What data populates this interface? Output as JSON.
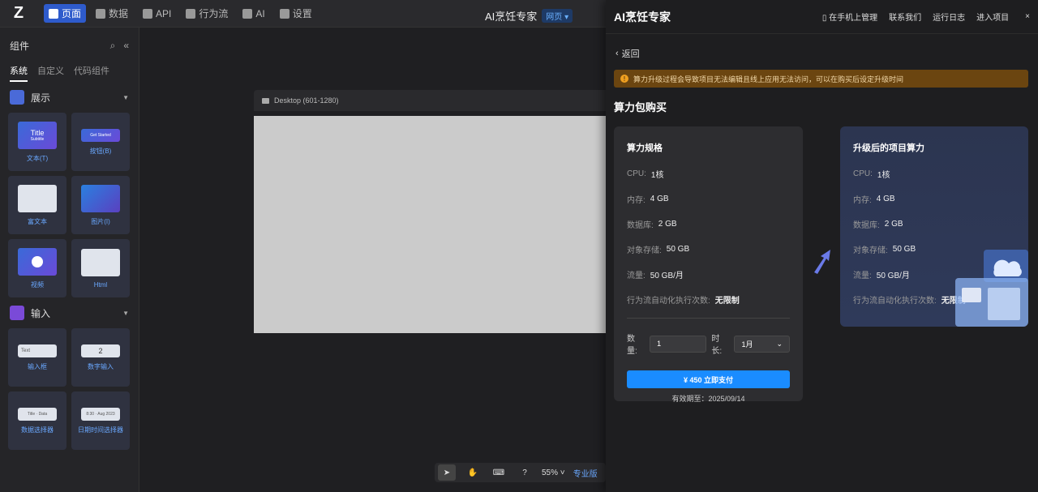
{
  "topbar": {
    "nav": [
      {
        "label": "页面",
        "icon": "page-icon",
        "active": true
      },
      {
        "label": "数据",
        "icon": "database-icon",
        "active": false
      },
      {
        "label": "API",
        "icon": "api-icon",
        "active": false
      },
      {
        "label": "行为流",
        "icon": "flow-icon",
        "active": false
      },
      {
        "label": "AI",
        "icon": "ai-icon",
        "active": false
      },
      {
        "label": "设置",
        "icon": "gear-icon",
        "active": false
      }
    ],
    "app_title": "AI烹饪专家",
    "app_badge": "网页"
  },
  "sidebar": {
    "title": "组件",
    "tabs": [
      "系统",
      "自定义",
      "代码组件"
    ],
    "section_display": "展示",
    "section_input": "输入",
    "display_items": [
      "文本(T)",
      "按钮(B)",
      "富文本",
      "图片(I)",
      "视频",
      "Html"
    ],
    "input_items": [
      "输入框",
      "数字输入",
      "数据选择器",
      "日期时间选择器"
    ],
    "thumb_text": {
      "title": "Title",
      "subtitle": "Subtitle",
      "get_started": "Get Started",
      "input_text": "Text",
      "stepper_value": "2",
      "select_text": "Title · Data",
      "date_text": "8:30 · Aug 2023"
    }
  },
  "canvas": {
    "frame_label": "Desktop (601-1280)"
  },
  "bottombar": {
    "zoom": "55%",
    "plan": "专业版"
  },
  "panel": {
    "title": "AI烹饪专家",
    "links": [
      "在手机上管理",
      "联系我们",
      "运行日志",
      "进入项目"
    ],
    "back": "返回",
    "warning": "算力升级过程会导致项目无法编辑且线上应用无法访问，可以在购买后设定升级时间",
    "heading": "算力包购买",
    "left_card": {
      "title": "算力规格",
      "specs": [
        {
          "label": "CPU:",
          "value": "1核"
        },
        {
          "label": "内存:",
          "value": "4 GB"
        },
        {
          "label": "数据库:",
          "value": "2 GB"
        },
        {
          "label": "对象存储:",
          "value": "50 GB"
        },
        {
          "label": "流量:",
          "value": "50 GB/月"
        },
        {
          "label": "行为流自动化执行次数:",
          "value": "无限制"
        }
      ],
      "qty_label": "数量:",
      "qty_value": "1",
      "duration_label": "时长:",
      "duration_value": "1月",
      "pay_button": "¥ 450  立即支付",
      "valid_until": "有效期至：2025/09/14"
    },
    "right_card": {
      "title": "升级后的项目算力",
      "specs": [
        {
          "label": "CPU:",
          "value": "1核"
        },
        {
          "label": "内存:",
          "value": "4 GB"
        },
        {
          "label": "数据库:",
          "value": "2 GB"
        },
        {
          "label": "对象存储:",
          "value": "50 GB"
        },
        {
          "label": "流量:",
          "value": "50 GB/月"
        },
        {
          "label": "行为流自动化执行次数:",
          "value": "无限制"
        }
      ]
    },
    "colors": {
      "accent": "#1a8cff",
      "warning_bg": "#6b4510"
    }
  }
}
